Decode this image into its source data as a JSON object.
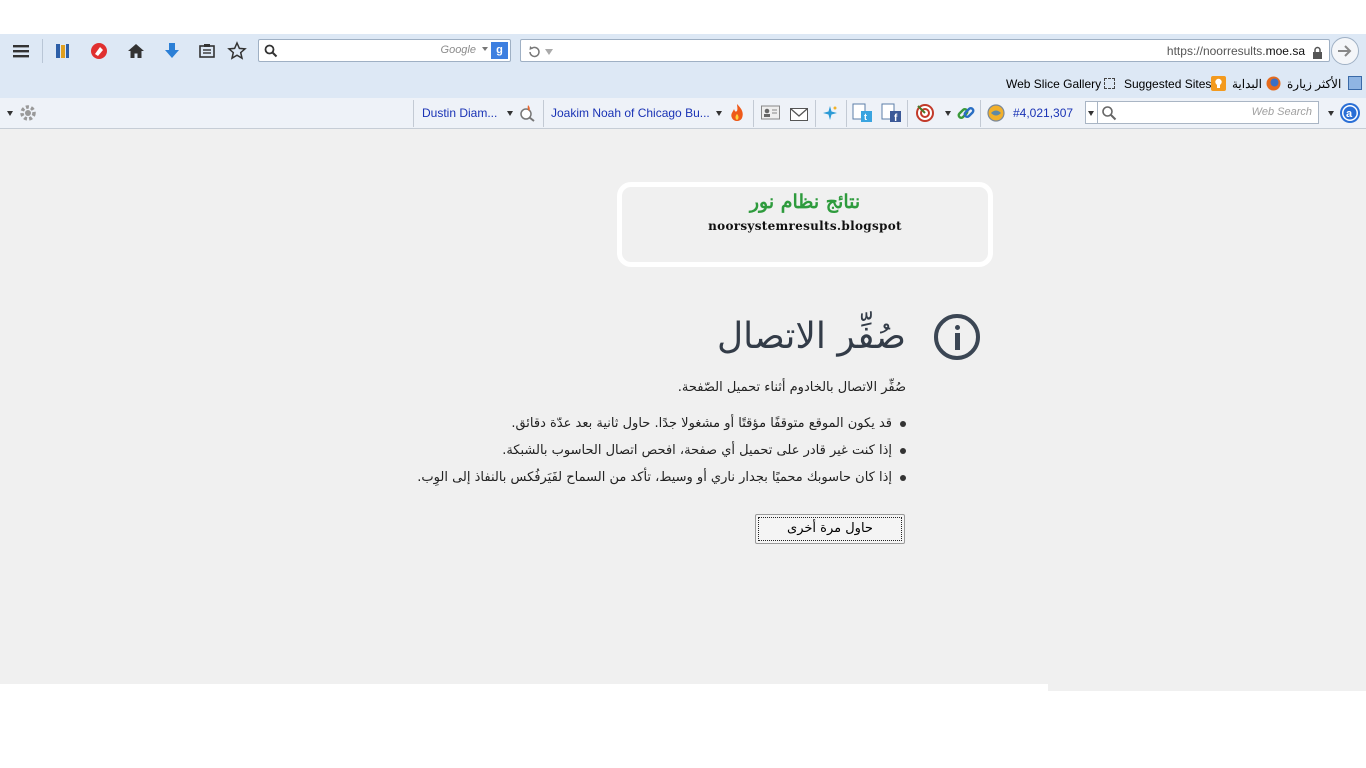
{
  "navbar": {
    "search_placeholder": "Google",
    "search_engine_badge": "g",
    "url_prefix": "https://noorresults.",
    "url_domain": "moe.sa"
  },
  "favorites": {
    "items": [
      {
        "label": "Web Slice Gallery",
        "icon": "web-slice-icon"
      },
      {
        "label": "Suggested Sites",
        "icon": "suggested-sites-icon"
      },
      {
        "label": "البداية",
        "icon": "firefox-icon"
      },
      {
        "label": "الأكثر زيارة",
        "icon": "most-visited-icon"
      }
    ]
  },
  "addonbar": {
    "news1": "Dustin Diam...",
    "news2": "Joakim Noah of Chicago Bu...",
    "rank": "#4,021,307",
    "web_search_placeholder": "Web Search"
  },
  "banner": {
    "title": "نتائج نظام نور",
    "subtitle": "noorsystemresults.blogspot"
  },
  "error": {
    "title": "صُفِّر الاتصال",
    "description": "صُفِّر الاتصال بالخادوم أثناء تحميل الصّفحة.",
    "tips": [
      "قد يكون الموقع متوقفًا مؤقتًا أو مشغولا جدًا. حاول ثانية بعد عدّة دقائق.",
      "إذا كنت غير قادر على تحميل أي صفحة، افحص اتصال الحاسوب بالشبكة.",
      "إذا كان حاسوبك محميًا بجدار ناري أو وسيط، تأكد من السماح لفَيَرفُكس بالنفاذ إلى الوِب."
    ],
    "retry_label": "حاول مرة أخرى"
  },
  "colors": {
    "toolbar_bg": "#dde8f5",
    "content_bg": "#f0f0f0",
    "banner_title": "#2e9b3d",
    "link_blue": "#1a33b5"
  }
}
